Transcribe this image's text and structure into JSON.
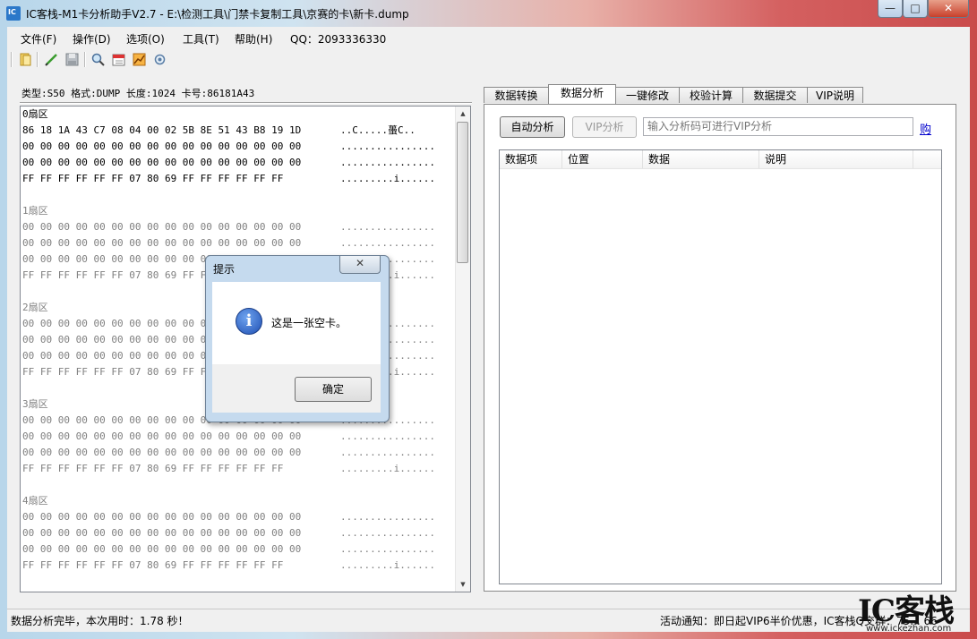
{
  "window": {
    "title": "IC客栈-M1卡分析助手V2.7 - E:\\检测工具\\门禁卡复制工具\\京赛的卡\\新卡.dump",
    "min": "—",
    "max": "□",
    "close": "✕"
  },
  "menu": [
    "文件(F)",
    "操作(D)",
    "选项(O)",
    "工具(T)",
    "帮助(H)",
    "QQ：2093336330"
  ],
  "card_info": "类型:S50 格式:DUMP 长度:1024 卡号:86181A43",
  "sectors": [
    {
      "label": "0扇区",
      "rows": [
        {
          "hex": "86 18 1A 43 C7 08 04 00 02 5B 8E 51 43 B8 19 1D",
          "ascii": "..C.....蠆C.."
        },
        {
          "hex": "00 00 00 00 00 00 00 00 00 00 00 00 00 00 00 00",
          "ascii": "................"
        },
        {
          "hex": "00 00 00 00 00 00 00 00 00 00 00 00 00 00 00 00",
          "ascii": "................"
        },
        {
          "hex": "FF FF FF FF FF FF 07 80 69 FF FF FF FF FF FF",
          "ascii": ".........i......"
        }
      ]
    },
    {
      "label": "1扇区",
      "rows": [
        {
          "hex": "00 00 00 00 00 00 00 00 00 00 00 00 00 00 00 00",
          "ascii": "................"
        },
        {
          "hex": "00 00 00 00 00 00 00 00 00 00 00 00 00 00 00 00",
          "ascii": "................"
        },
        {
          "hex": "00 00 00 00 00 00 00 00 00 00 00 00 00 00 00 00",
          "ascii": "................"
        },
        {
          "hex": "FF FF FF FF FF FF 07 80 69 FF FF FF FF FF FF",
          "ascii": ".........i......"
        }
      ]
    },
    {
      "label": "2扇区",
      "rows": [
        {
          "hex": "00 00 00 00 00 00 00 00 00 00 00 00 00 00 00 00",
          "ascii": "................"
        },
        {
          "hex": "00 00 00 00 00 00 00 00 00 00 00 00 00 00 00 00",
          "ascii": "................"
        },
        {
          "hex": "00 00 00 00 00 00 00 00 00 00 00 00 00 00 00 00",
          "ascii": "................"
        },
        {
          "hex": "FF FF FF FF FF FF 07 80 69 FF FF FF FF FF FF",
          "ascii": ".........i......"
        }
      ]
    },
    {
      "label": "3扇区",
      "rows": [
        {
          "hex": "00 00 00 00 00 00 00 00 00 00 00 00 00 00 00 00",
          "ascii": "................"
        },
        {
          "hex": "00 00 00 00 00 00 00 00 00 00 00 00 00 00 00 00",
          "ascii": "................"
        },
        {
          "hex": "00 00 00 00 00 00 00 00 00 00 00 00 00 00 00 00",
          "ascii": "................"
        },
        {
          "hex": "FF FF FF FF FF FF 07 80 69 FF FF FF FF FF FF",
          "ascii": ".........i......"
        }
      ]
    },
    {
      "label": "4扇区",
      "rows": [
        {
          "hex": "00 00 00 00 00 00 00 00 00 00 00 00 00 00 00 00",
          "ascii": "................"
        },
        {
          "hex": "00 00 00 00 00 00 00 00 00 00 00 00 00 00 00 00",
          "ascii": "................"
        },
        {
          "hex": "00 00 00 00 00 00 00 00 00 00 00 00 00 00 00 00",
          "ascii": "................"
        },
        {
          "hex": "FF FF FF FF FF FF 07 80 69 FF FF FF FF FF FF",
          "ascii": ".........i......"
        }
      ]
    }
  ],
  "tabs": [
    "数据转换",
    "数据分析",
    "一键修改",
    "校验计算",
    "数据提交",
    "VIP说明"
  ],
  "active_tab": "数据分析",
  "analysis": {
    "auto_button": "自动分析",
    "vip_button": "VIP分析",
    "vip_placeholder": "输入分析码可进行VIP分析",
    "buy_link": "购",
    "columns": [
      "数据项",
      "位置",
      "数据",
      "说明"
    ]
  },
  "status": {
    "left": "数据分析完毕，本次用时：1.78 秒！",
    "right": "活动通知：即日起VIP6半价优惠，IC客栈Q交群：75... 66"
  },
  "watermark": {
    "text": "IC客栈",
    "url": "www.ickezhan.com"
  },
  "dialog": {
    "title": "提示",
    "message": "这是一张空卡。",
    "ok": "确定",
    "close": "✕",
    "icon_glyph": "i"
  },
  "icons": [
    "open-folder-icon",
    "pencil-icon",
    "save-icon",
    "search-icon",
    "calendar-icon",
    "chart-icon",
    "settings-icon"
  ]
}
